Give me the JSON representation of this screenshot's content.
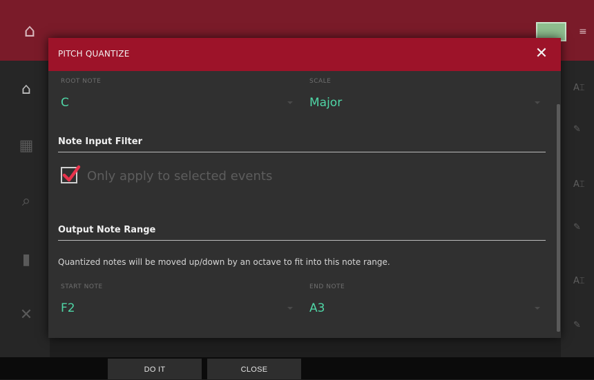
{
  "dialog": {
    "title": "PITCH QUANTIZE",
    "fields": {
      "root_note": {
        "label": "ROOT NOTE",
        "value": "C"
      },
      "scale": {
        "label": "SCALE",
        "value": "Major"
      },
      "start_note": {
        "label": "START NOTE",
        "value": "F2"
      },
      "end_note": {
        "label": "END NOTE",
        "value": "A3"
      }
    },
    "sections": {
      "note_input_filter": "Note Input Filter",
      "output_note_range": "Output Note Range"
    },
    "checkbox": {
      "label": "Only apply to selected events",
      "checked": true
    },
    "description": "Quantized notes will be moved up/down by an octave to fit into this note range.",
    "colors": {
      "header": "#9d1329",
      "value_text": "#4fd6a6",
      "check": "#e8334c"
    }
  },
  "footer": {
    "do_it": "DO IT",
    "close": "CLOSE"
  },
  "icons": [
    "home-icon",
    "grid-icon",
    "search-icon",
    "bars-icon",
    "xy-icon",
    "close-icon",
    "pencil-icon",
    "text-cursor-icon",
    "menu-icon"
  ]
}
